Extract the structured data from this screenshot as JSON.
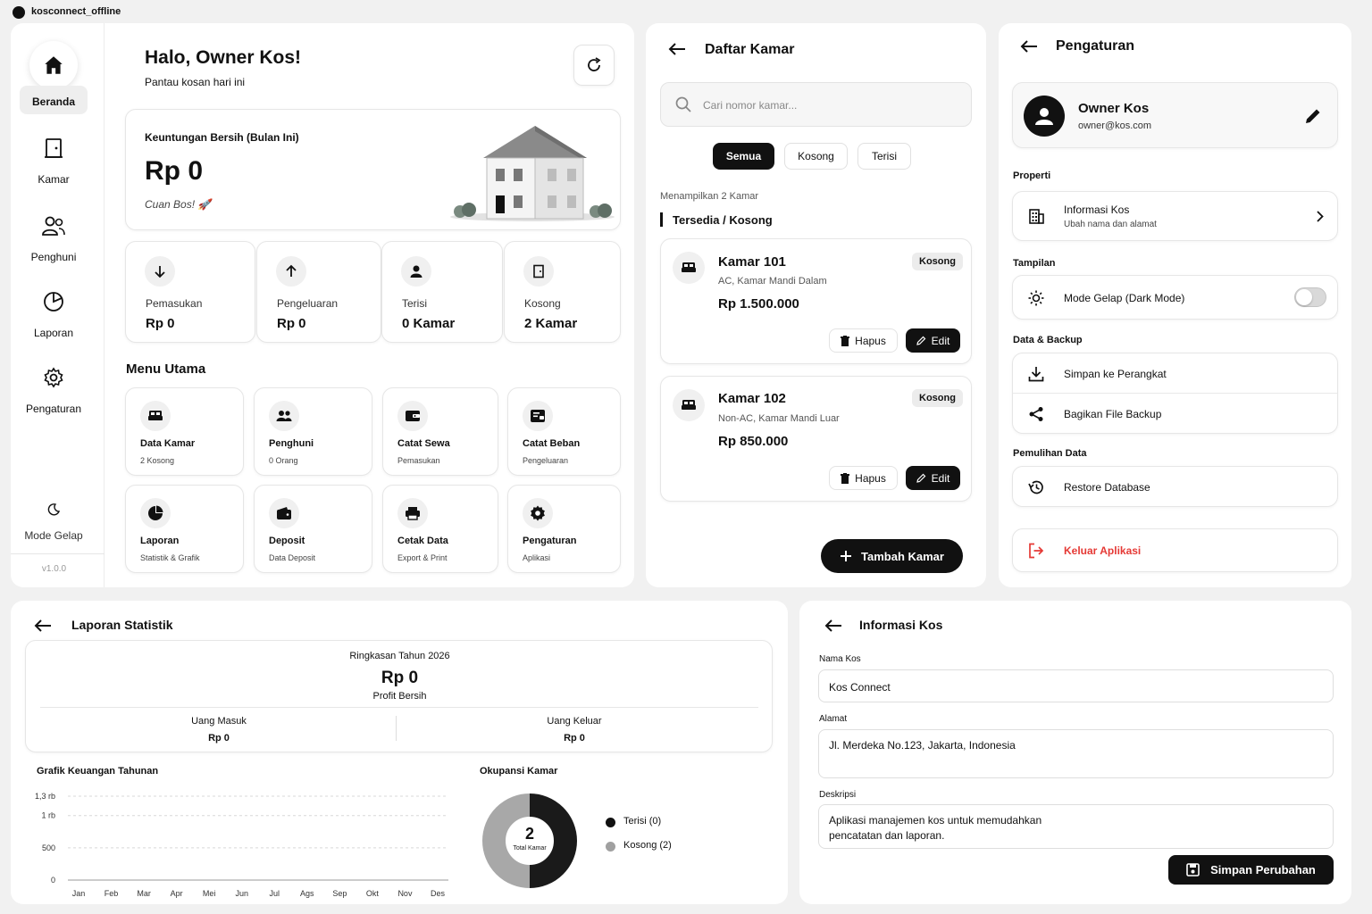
{
  "titlebar": {
    "app_name": "kosconnect_offline"
  },
  "sidebar": {
    "items": [
      {
        "label": "Beranda",
        "icon": "home-icon"
      },
      {
        "label": "Kamar",
        "icon": "door-icon"
      },
      {
        "label": "Penghuni",
        "icon": "users-icon"
      },
      {
        "label": "Laporan",
        "icon": "pie-chart-icon"
      },
      {
        "label": "Pengaturan",
        "icon": "gear-icon"
      }
    ],
    "dark_mode_label": "Mode Gelap",
    "version": "v1.0.0"
  },
  "dashboard": {
    "greeting": "Halo, Owner Kos!",
    "subtitle": "Pantau kosan hari ini",
    "profit_card": {
      "label": "Keuntungan Bersih (Bulan Ini)",
      "value": "Rp 0",
      "note": "Cuan Bos! 🚀"
    },
    "stats": [
      {
        "label": "Pemasukan",
        "value": "Rp 0",
        "icon": "arrow-down-icon"
      },
      {
        "label": "Pengeluaran",
        "value": "Rp 0",
        "icon": "arrow-up-icon"
      },
      {
        "label": "Terisi",
        "value": "0 Kamar",
        "icon": "person-icon"
      },
      {
        "label": "Kosong",
        "value": "2 Kamar",
        "icon": "door-icon"
      }
    ],
    "menu_title": "Menu Utama",
    "menu": [
      {
        "title": "Data Kamar",
        "sub": "2 Kosong",
        "icon": "bed-icon"
      },
      {
        "title": "Penghuni",
        "sub": "0 Orang",
        "icon": "people-icon"
      },
      {
        "title": "Catat Sewa",
        "sub": "Pemasukan",
        "icon": "wallet-icon"
      },
      {
        "title": "Catat Beban",
        "sub": "Pengeluaran",
        "icon": "receipt-icon"
      },
      {
        "title": "Laporan",
        "sub": "Statistik & Grafik",
        "icon": "pie-icon"
      },
      {
        "title": "Deposit",
        "sub": "Data Deposit",
        "icon": "deposit-wallet-icon"
      },
      {
        "title": "Cetak Data",
        "sub": "Export & Print",
        "icon": "printer-icon"
      },
      {
        "title": "Pengaturan",
        "sub": "Aplikasi",
        "icon": "gear-icon"
      }
    ]
  },
  "rooms": {
    "title": "Daftar Kamar",
    "search_placeholder": "Cari nomor kamar...",
    "filters": [
      "Semua",
      "Kosong",
      "Terisi"
    ],
    "active_filter": "Semua",
    "count_text": "Menampilkan 2 Kamar",
    "section_label": "Tersedia / Kosong",
    "list": [
      {
        "name": "Kamar 101",
        "desc": "AC, Kamar Mandi Dalam",
        "price": "Rp 1.500.000",
        "status": "Kosong"
      },
      {
        "name": "Kamar 102",
        "desc": "Non-AC, Kamar Mandi Luar",
        "price": "Rp 850.000",
        "status": "Kosong"
      }
    ],
    "delete_label": "Hapus",
    "edit_label": "Edit",
    "add_label": "Tambah Kamar"
  },
  "settings": {
    "title": "Pengaturan",
    "profile": {
      "name": "Owner Kos",
      "email": "owner@kos.com"
    },
    "sections": {
      "properti": "Properti",
      "tampilan": "Tampilan",
      "backup": "Data & Backup",
      "pemulihan": "Pemulihan Data"
    },
    "info_kos": {
      "title": "Informasi Kos",
      "sub": "Ubah nama dan alamat"
    },
    "dark_mode": "Mode Gelap (Dark Mode)",
    "dark_mode_on": false,
    "save_device": "Simpan ke Perangkat",
    "share_backup": "Bagikan File Backup",
    "restore": "Restore Database",
    "logout": "Keluar Aplikasi",
    "logout_color": "#e53935"
  },
  "report": {
    "title": "Laporan Statistik",
    "summary_title": "Ringkasan Tahun 2026",
    "profit_value": "Rp 0",
    "profit_label": "Profit Bersih",
    "in_label": "Uang Masuk",
    "in_value": "Rp 0",
    "out_label": "Uang Keluar",
    "out_value": "Rp 0",
    "chart_title": "Grafik Keuangan Tahunan",
    "occupancy_title": "Okupansi Kamar",
    "donut_center_value": "2",
    "donut_center_label": "Total Kamar",
    "legend": [
      {
        "label": "Terisi (0)",
        "color": "#111111"
      },
      {
        "label": "Kosong (2)",
        "color": "#a0a0a0"
      }
    ]
  },
  "chart_data": [
    {
      "type": "line",
      "title": "Grafik Keuangan Tahunan",
      "categories": [
        "Jan",
        "Feb",
        "Mar",
        "Apr",
        "Mei",
        "Jun",
        "Jul",
        "Ags",
        "Sep",
        "Okt",
        "Nov",
        "Des"
      ],
      "yticks": [
        "0",
        "500",
        "1 rb",
        "1,3 rb"
      ],
      "ylim": [
        0,
        1300
      ],
      "series": [],
      "grid": true
    },
    {
      "type": "pie",
      "title": "Okupansi Kamar",
      "categories": [
        "Terisi (0)",
        "Kosong (2)"
      ],
      "values": [
        1,
        1
      ],
      "colors": [
        "#1a1a1a",
        "#a8a8a8"
      ]
    }
  ],
  "info_kos_form": {
    "title": "Informasi Kos",
    "name_label": "Nama Kos",
    "name_value": "Kos Connect",
    "address_label": "Alamat",
    "address_value": "Jl. Merdeka No.123, Jakarta, Indonesia",
    "desc_label": "Deskripsi",
    "desc_value_line1": "Aplikasi manajemen kos untuk memudahkan",
    "desc_value_line2": "pencatatan dan laporan.",
    "save_label": "Simpan Perubahan"
  }
}
